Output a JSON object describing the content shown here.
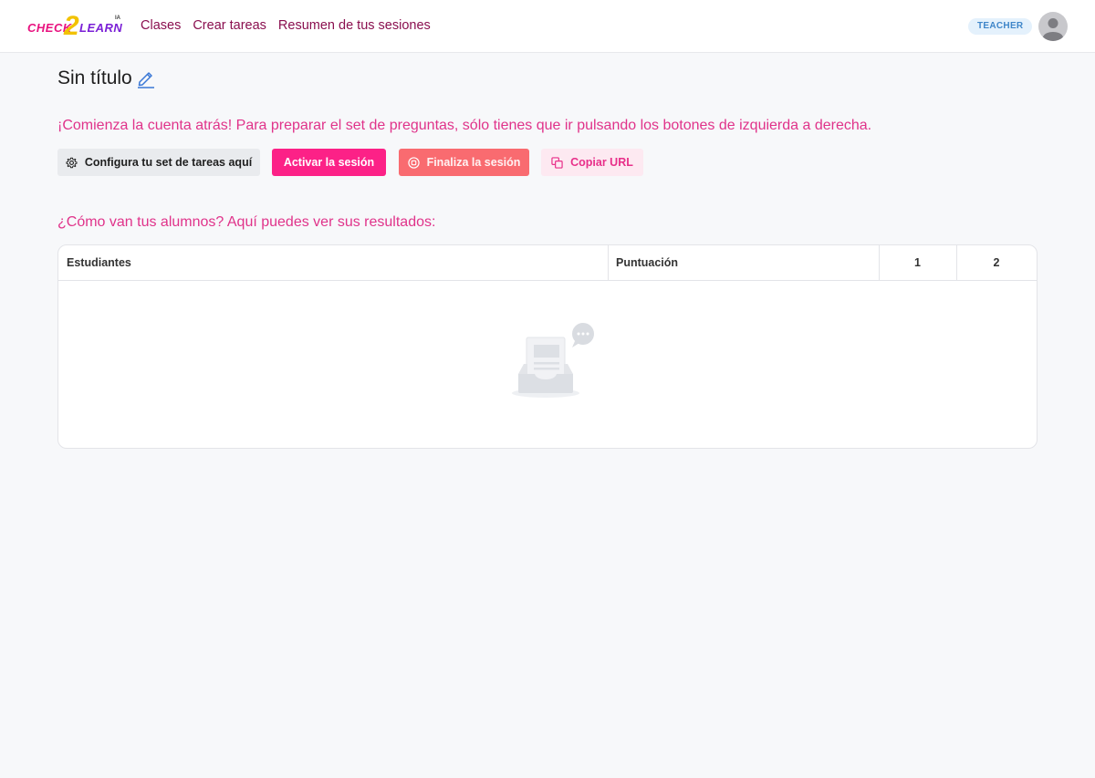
{
  "app": {
    "logo": {
      "part1": "CHECK",
      "part2": "2",
      "part3": "LEARN",
      "suffix": "IA"
    },
    "nav": [
      "Clases",
      "Crear tareas",
      "Resumen de tus sesiones"
    ],
    "role": "TEACHER"
  },
  "page": {
    "title": "Sin título",
    "intro": "¡Comienza la cuenta atrás! Para preparar el set de preguntas, sólo tienes que ir pulsando los botones de izquierda a derecha.",
    "buttons": {
      "configure": "Configura tu set de tareas aquí",
      "activate": "Activar la sesión",
      "finish": "Finaliza la sesión",
      "copy": "Copiar URL"
    },
    "results_title": "¿Cómo van tus alumnos? Aquí puedes ver sus resultados:"
  },
  "table": {
    "columns": [
      "Estudiantes",
      "Puntuación",
      "1",
      "2"
    ],
    "rows": []
  },
  "colors": {
    "accent": "#fc2187",
    "finish": "#f96b70",
    "text_pink": "#e0338a",
    "nav": "#8a0f4f"
  },
  "icons": {
    "edit": "pencil-icon",
    "configure": "gear-icon",
    "finish": "stop-circle-icon",
    "copy": "copy-icon",
    "empty": "empty-inbox-icon",
    "avatar": "user-avatar-icon"
  }
}
